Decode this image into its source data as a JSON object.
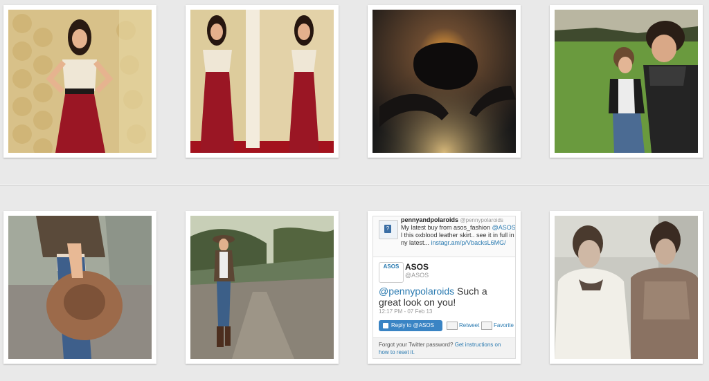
{
  "photos": [
    {
      "name": "photo-woman-red-maxi-skirt",
      "alt": "Woman in red maxi skirt against patterned wallpaper"
    },
    {
      "name": "photo-woman-red-skirt-mirror",
      "alt": "Woman in red maxi skirt, two poses"
    },
    {
      "name": "photo-couple-silhouette",
      "alt": "Couple silhouette with glowing light"
    },
    {
      "name": "photo-couple-running-field",
      "alt": "Couple running on green field"
    },
    {
      "name": "photo-hand-holding-hat",
      "alt": "Hand holding a brown felt hat"
    },
    {
      "name": "photo-woman-forest-path",
      "alt": "Woman walking on a forest path"
    },
    {
      "name": "photo-two-women-fur",
      "alt": "Two women in fur jackets"
    }
  ],
  "tweet": {
    "user": "pennyandpolaroids",
    "handle": "@pennypolaroids",
    "text_lead": "My latest buy from asos_fashion ",
    "text_mention": "@ASOS",
    "text_rest": " I l this oxblood leather skirt.. see it in full in ny latest... ",
    "text_link": "instagr.am/p/VbacksL6MG/",
    "reply_account_logo": "ASOS",
    "reply_account_name": "ASOS",
    "reply_account_handle": "@ASOS",
    "reply_mention": "@pennypolaroids",
    "reply_text": " Such a great look on you!",
    "timestamp": "12:17 PM - 07 Feb 13",
    "reply_button": "Reply to @ASOS",
    "retweet_label": "Retweet",
    "favorite_label": "Favorite",
    "footer_text": "Forgot your Twitter password? ",
    "footer_link": "Get instructions on how to reset it."
  },
  "colors": {
    "background": "#e9e9e9",
    "link": "#2a7ab0",
    "button": "#3a84c4"
  }
}
